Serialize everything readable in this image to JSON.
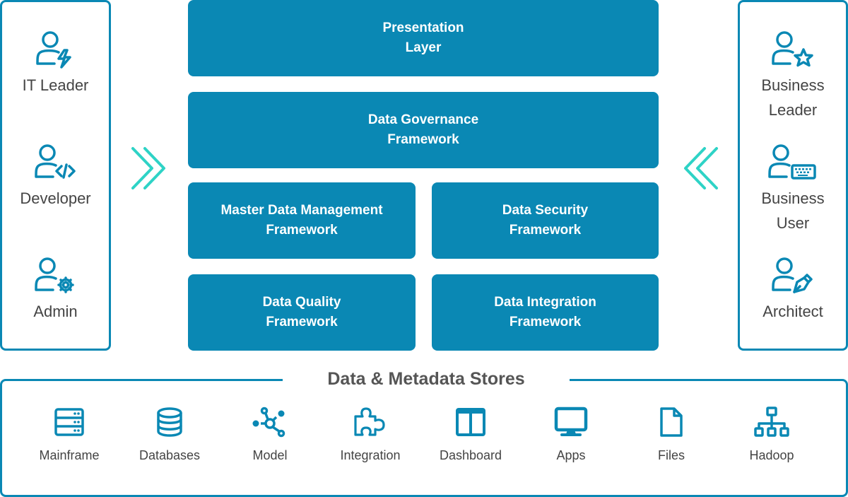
{
  "left_panel": {
    "personas": [
      {
        "label": "IT Leader",
        "icon": "user-bolt-icon"
      },
      {
        "label": "Developer",
        "icon": "user-code-icon"
      },
      {
        "label": "Admin",
        "icon": "user-gear-icon"
      }
    ]
  },
  "right_panel": {
    "personas": [
      {
        "label": "Business\nLeader",
        "icon": "user-star-icon"
      },
      {
        "label": "Business\nUser",
        "icon": "user-keyboard-icon"
      },
      {
        "label": "Architect",
        "icon": "user-pen-icon"
      }
    ]
  },
  "arrows": {
    "left": "double-chevron-right-icon",
    "right": "double-chevron-left-icon"
  },
  "layers": {
    "presentation": "Presentation\nLayer",
    "governance": "Data Governance\nFramework",
    "mdm": "Master Data Management\nFramework",
    "security": "Data Security\nFramework",
    "quality": "Data Quality\nFramework",
    "integration": "Data Integration\nFramework"
  },
  "stores": {
    "title": "Data & Metadata Stores",
    "items": [
      {
        "label": "Mainframe",
        "icon": "server-icon"
      },
      {
        "label": "Databases",
        "icon": "database-icon"
      },
      {
        "label": "Model",
        "icon": "network-node-icon"
      },
      {
        "label": "Integration",
        "icon": "puzzle-icon"
      },
      {
        "label": "Dashboard",
        "icon": "columns-icon"
      },
      {
        "label": "Apps",
        "icon": "monitor-icon"
      },
      {
        "label": "Files",
        "icon": "file-icon"
      },
      {
        "label": "Hadoop",
        "icon": "hierarchy-icon"
      }
    ]
  },
  "colors": {
    "primary": "#0a88b4",
    "accent": "#2ed3c6",
    "text": "#444444"
  }
}
